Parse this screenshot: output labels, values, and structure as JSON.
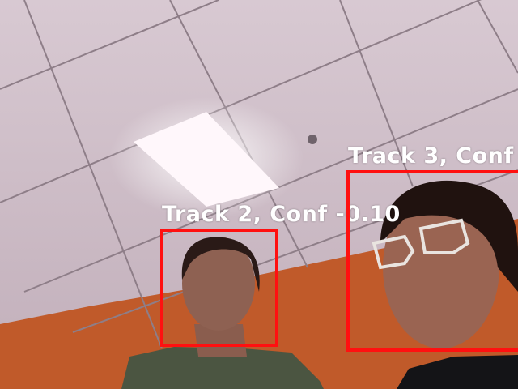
{
  "detections": [
    {
      "label": "Track 2, Conf -0.10",
      "color": "#ff1010"
    },
    {
      "label": "Track 3, Conf",
      "color": "#ff1010"
    }
  ]
}
